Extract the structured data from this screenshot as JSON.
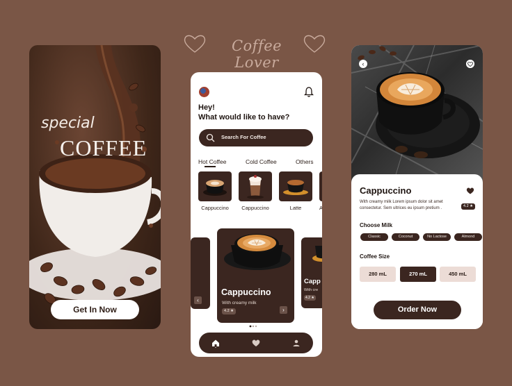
{
  "brand": {
    "title": "Coffee Lover"
  },
  "welcome": {
    "special": "special",
    "headline": "COFFEE",
    "cta": "Get In Now"
  },
  "home": {
    "greeting_line1": "Hey!",
    "greeting_line2": "What would like to have?",
    "search_placeholder": "Search For Coffee",
    "tabs": [
      "Hot Coffee",
      "Cold Coffee",
      "Others"
    ],
    "products": [
      {
        "label": "Cappuccino"
      },
      {
        "label": "Cappuccino"
      },
      {
        "label": "Latte"
      },
      {
        "label": "A"
      }
    ],
    "featured": {
      "name": "Cappuccino",
      "desc": "With creamy milk",
      "rating": "4.2 ★"
    },
    "next_card": {
      "name": "Capp",
      "desc": "With cre",
      "rating": "4.2 ★"
    },
    "active_page_dot": 1,
    "page_dot_count": 3
  },
  "detail": {
    "name": "Cappuccino",
    "description": "With creamy milk Lorem ipsum dolor sit amet consectetur. Sem ultrices eu ipsum pretium .",
    "rating": "4.2 ★",
    "milk_heading": "Choose Milk",
    "milk_options": [
      "Classic",
      "Coconut",
      "No Lactose",
      "Almond"
    ],
    "size_heading": "Coffee Size",
    "sizes": [
      "280 mL",
      "270 mL",
      "450 mL"
    ],
    "selected_size": "270 mL",
    "order_label": "Order Now"
  },
  "colors": {
    "background": "#7a5646",
    "dark": "#3b2620",
    "light_chip": "#ecdcd6"
  }
}
